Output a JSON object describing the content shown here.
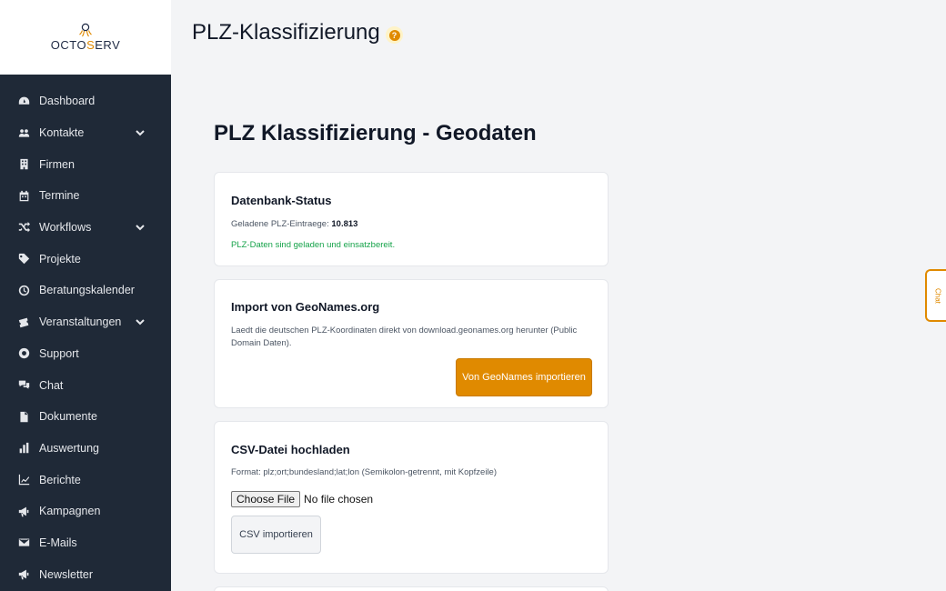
{
  "app": {
    "logo": {
      "part1": "OCTO",
      "accent": "S",
      "part2": "ERV"
    },
    "accent_color": "#e08a00",
    "sidebar_color": "#1f2937"
  },
  "sidebar": {
    "items": [
      {
        "label": "Dashboard",
        "icon": "dashboard-icon"
      },
      {
        "label": "Kontakte",
        "icon": "users-icon",
        "expandable": true
      },
      {
        "label": "Firmen",
        "icon": "building-icon"
      },
      {
        "label": "Termine",
        "icon": "calendar-icon"
      },
      {
        "label": "Workflows",
        "icon": "shuffle-icon",
        "expandable": true
      },
      {
        "label": "Projekte",
        "icon": "tag-icon"
      },
      {
        "label": "Beratungskalender",
        "icon": "clock-icon"
      },
      {
        "label": "Veranstaltungen",
        "icon": "ticket-icon",
        "expandable": true
      },
      {
        "label": "Support",
        "icon": "lifebuoy-icon"
      },
      {
        "label": "Chat",
        "icon": "chat-icon"
      },
      {
        "label": "Dokumente",
        "icon": "document-icon"
      },
      {
        "label": "Auswertung",
        "icon": "bar-chart-icon"
      },
      {
        "label": "Berichte",
        "icon": "line-chart-icon"
      },
      {
        "label": "Kampagnen",
        "icon": "megaphone-icon"
      },
      {
        "label": "E-Mails",
        "icon": "envelope-icon"
      },
      {
        "label": "Newsletter",
        "icon": "megaphone-icon"
      }
    ]
  },
  "header": {
    "title": "PLZ-Klassifizierung",
    "help": "?"
  },
  "main": {
    "heading": "PLZ Klassifizierung - Geodaten",
    "status_card": {
      "title": "Datenbank-Status",
      "loaded_label": "Geladene PLZ-Eintraege: ",
      "loaded_count": "10.813",
      "status_text": "PLZ-Daten sind geladen und einsatzbereit."
    },
    "import_card": {
      "title": "Import von GeoNames.org",
      "description": "Laedt die deutschen PLZ-Koordinaten direkt von download.geonames.org herunter (Public Domain Daten).",
      "button": "Von GeoNames importieren"
    },
    "csv_card": {
      "title": "CSV-Datei hochladen",
      "format": "Format: plz;ort;bundesland;lat;lon (Semikolon-getrennt, mit Kopfzeile)",
      "choose_file": "Choose File",
      "file_status": "No file chosen",
      "button": "CSV importieren"
    }
  },
  "chat_tab": {
    "label": "Chat"
  }
}
